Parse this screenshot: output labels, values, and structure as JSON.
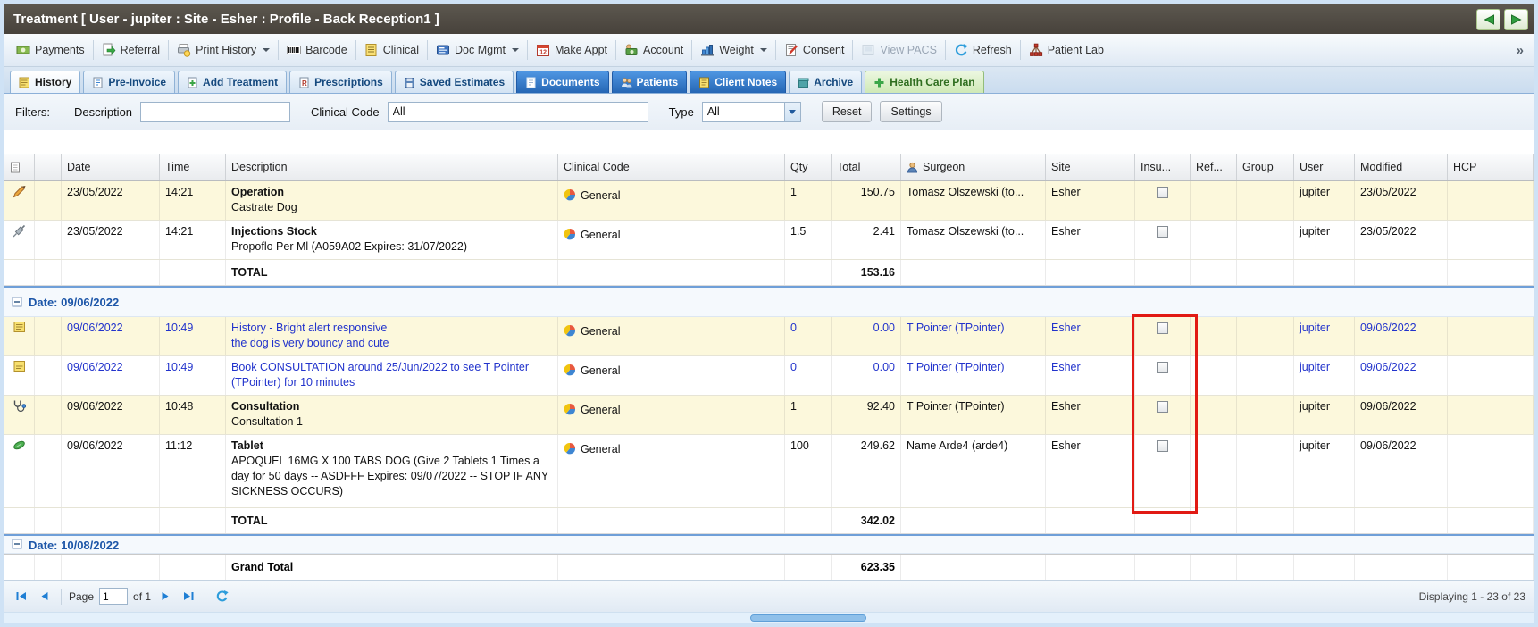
{
  "window": {
    "title": "Treatment [ User - jupiter : Site - Esher : Profile - Back Reception1 ]"
  },
  "toolbar": {
    "items": [
      {
        "label": "Payments"
      },
      {
        "label": "Referral"
      },
      {
        "label": "Print History"
      },
      {
        "label": "Barcode"
      },
      {
        "label": "Clinical"
      },
      {
        "label": "Doc Mgmt"
      },
      {
        "label": "Make Appt"
      },
      {
        "label": "Account"
      },
      {
        "label": "Weight"
      },
      {
        "label": "Consent"
      },
      {
        "label": "View PACS"
      },
      {
        "label": "Refresh"
      },
      {
        "label": "Patient Lab"
      }
    ],
    "overflow": "»"
  },
  "tabs": [
    {
      "label": "History"
    },
    {
      "label": "Pre-Invoice"
    },
    {
      "label": "Add Treatment"
    },
    {
      "label": "Prescriptions"
    },
    {
      "label": "Saved Estimates"
    },
    {
      "label": "Documents"
    },
    {
      "label": "Patients"
    },
    {
      "label": "Client Notes"
    },
    {
      "label": "Archive"
    },
    {
      "label": "Health Care Plan"
    }
  ],
  "filters": {
    "title": "Filters:",
    "description_label": "Description",
    "description_value": "",
    "clinical_code_label": "Clinical Code",
    "clinical_code_value": "All",
    "type_label": "Type",
    "type_value": "All",
    "reset_label": "Reset",
    "settings_label": "Settings"
  },
  "grid": {
    "columns": [
      "Date",
      "Time",
      "Description",
      "Clinical Code",
      "Qty",
      "Total",
      "Surgeon",
      "Site",
      "Insu...",
      "Ref...",
      "Group",
      "User",
      "Modified",
      "HCP"
    ],
    "rows": [
      {
        "date": "23/05/2022",
        "time": "14:21",
        "title": "Operation",
        "sub": "Castrate Dog",
        "code": "General",
        "qty": "1",
        "total": "150.75",
        "surgeon": "Tomasz Olszewski (to...",
        "site": "Esher",
        "user": "jupiter",
        "modified": "23/05/2022"
      },
      {
        "date": "23/05/2022",
        "time": "14:21",
        "title": "Injections Stock",
        "sub": "Propoflo Per Ml (A059A02 Expires: 31/07/2022)",
        "code": "General",
        "qty": "1.5",
        "total": "2.41",
        "surgeon": "Tomasz Olszewski (to...",
        "site": "Esher",
        "user": "jupiter",
        "modified": "23/05/2022"
      },
      {
        "date": "09/06/2022",
        "time": "10:49",
        "title": "History - Bright alert responsive",
        "sub": "the dog is very bouncy and cute",
        "code": "General",
        "qty": "0",
        "total": "0.00",
        "surgeon": "T Pointer (TPointer)",
        "site": "Esher",
        "user": "jupiter",
        "modified": "09/06/2022"
      },
      {
        "date": "09/06/2022",
        "time": "10:49",
        "title": "Book CONSULTATION around 25/Jun/2022 to see T Pointer (TPointer) for 10 minutes",
        "sub": "",
        "code": "General",
        "qty": "0",
        "total": "0.00",
        "surgeon": "T Pointer (TPointer)",
        "site": "Esher",
        "user": "jupiter",
        "modified": "09/06/2022"
      },
      {
        "date": "09/06/2022",
        "time": "10:48",
        "title": "Consultation",
        "sub": "Consultation 1",
        "code": "General",
        "qty": "1",
        "total": "92.40",
        "surgeon": "T Pointer (TPointer)",
        "site": "Esher",
        "user": "jupiter",
        "modified": "09/06/2022"
      },
      {
        "date": "09/06/2022",
        "time": "11:12",
        "title": "Tablet",
        "sub": "APOQUEL 16MG X 100 TABS DOG (Give 2 Tablets 1 Times a day for 50 days -- ASDFFF Expires: 09/07/2022 -- STOP IF ANY SICKNESS OCCURS)",
        "code": "General",
        "qty": "100",
        "total": "249.62",
        "surgeon": "Name Arde4 (arde4)",
        "site": "Esher",
        "user": "jupiter",
        "modified": "09/06/2022"
      }
    ],
    "groups": [
      {
        "label": "Date: 09/06/2022"
      },
      {
        "label": "Date: 10/08/2022"
      }
    ],
    "totals": [
      {
        "label": "TOTAL",
        "value": "153.16"
      },
      {
        "label": "TOTAL",
        "value": "342.02"
      }
    ],
    "grand_total": {
      "label": "Grand Total",
      "value": "623.35"
    }
  },
  "paging": {
    "page_label": "Page",
    "page_value": "1",
    "of_label": "of 1",
    "status": "Displaying 1 - 23 of 23"
  },
  "colors": {
    "window_border": "#2e86d8",
    "highlight_red": "#e11a14",
    "row_cream": "#fcf8dc",
    "tab_selected_blue": "#2f78cf",
    "tab_green_bg": "#ddefc6",
    "group_text_blue": "#1d56a8",
    "link_blue": "#2233cc"
  }
}
